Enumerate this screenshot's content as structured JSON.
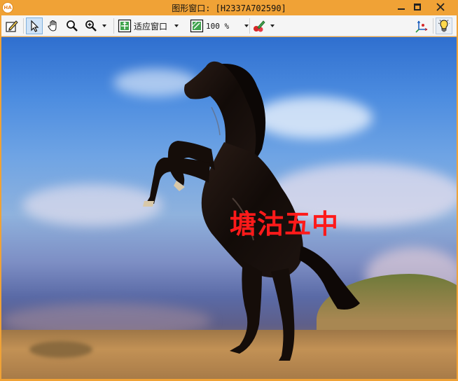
{
  "window": {
    "title": "图形窗口: [H2337A702590]",
    "app_icon_text": "HA",
    "minimize_icon": "minimize-icon",
    "maximize_icon": "maximize-icon",
    "close_icon": "close-icon"
  },
  "toolbar": {
    "tools": [
      {
        "name": "edit-draw-icon"
      },
      {
        "name": "pointer-icon",
        "active": true
      },
      {
        "name": "hand-pan-icon"
      },
      {
        "name": "magnifier-icon"
      },
      {
        "name": "zoom-in-icon"
      }
    ],
    "fit_mode_label": "适应窗口",
    "zoom_value": "100 %",
    "color_tool_icon": "color-picker-icon",
    "axes_icon": "axes-icon",
    "light_icon": "lightbulb-icon"
  },
  "canvas": {
    "overlay_text": "塘沽五中",
    "overlay_color": "#ff1a1a"
  }
}
